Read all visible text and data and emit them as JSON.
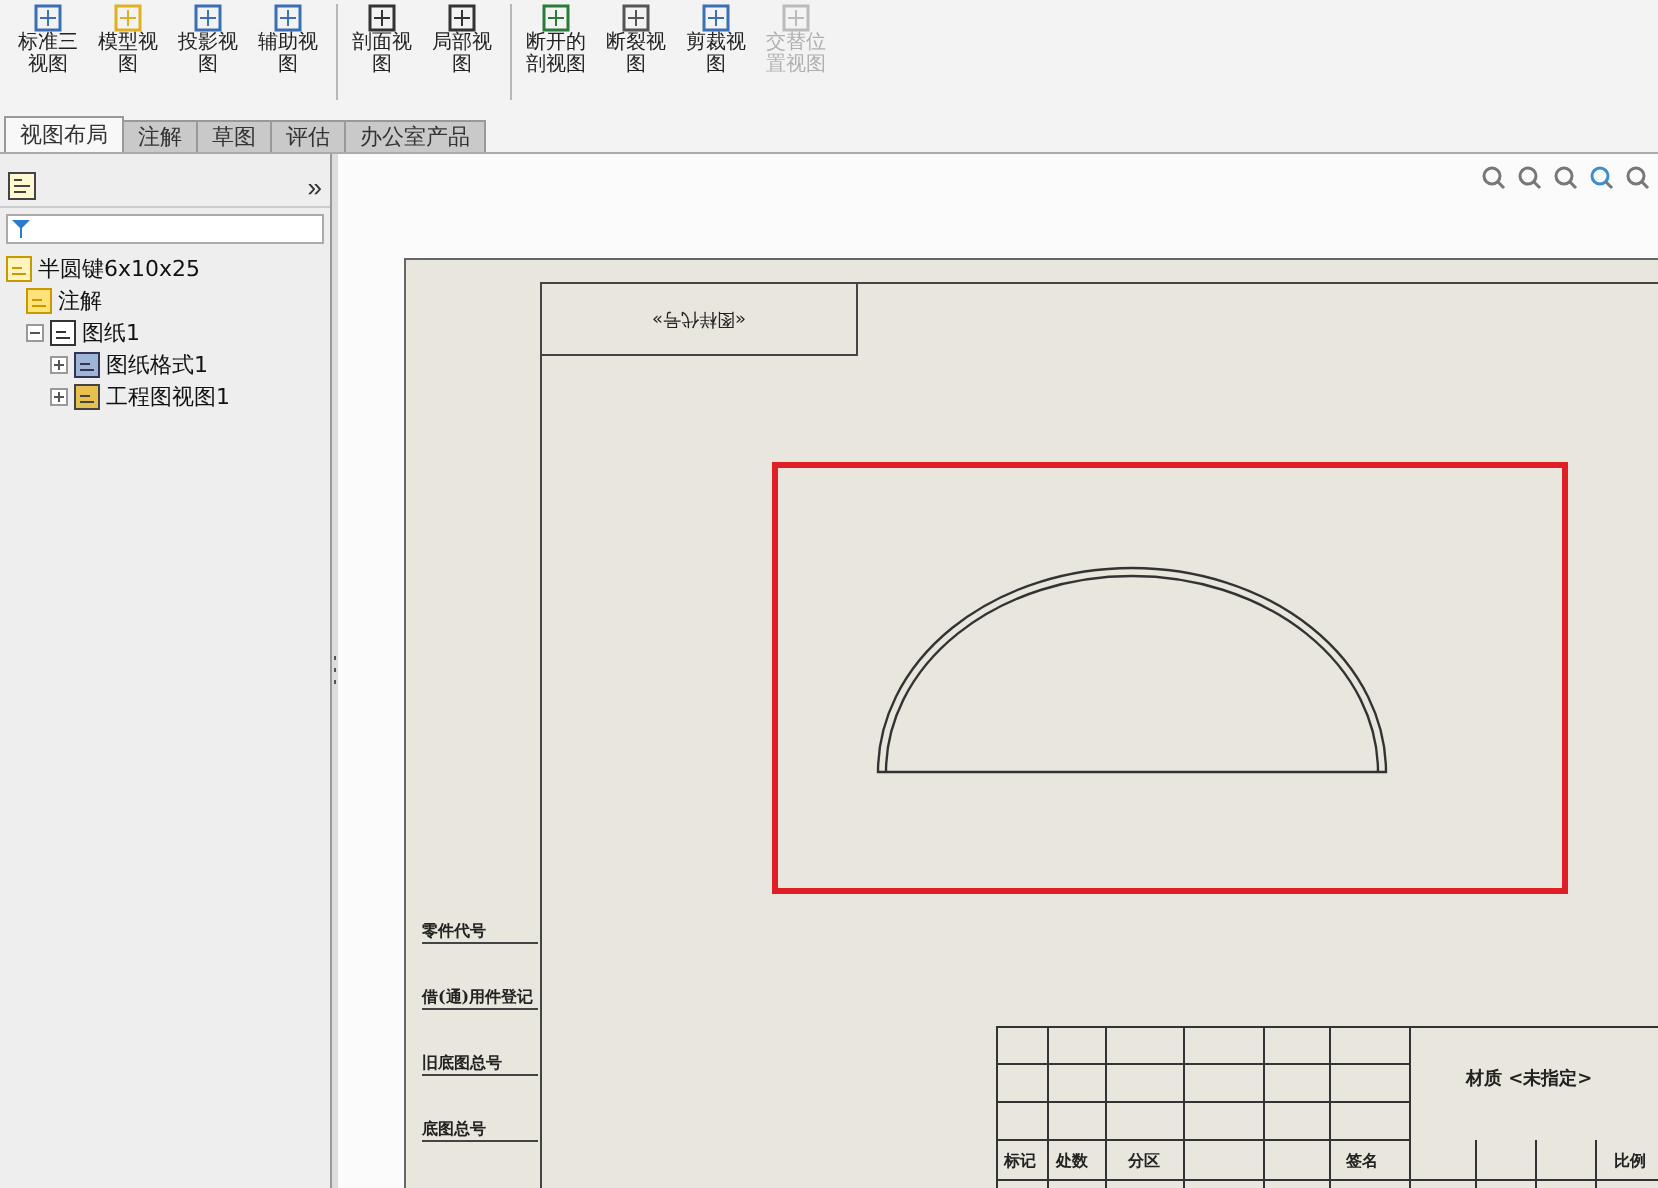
{
  "toolbar": {
    "groups": [
      [
        {
          "lines": [
            "标准三",
            "视图"
          ],
          "kind": "standard",
          "disabled": false
        },
        {
          "lines": [
            "模型视",
            "图"
          ],
          "kind": "model",
          "disabled": false
        },
        {
          "lines": [
            "投影视",
            "图"
          ],
          "kind": "projected",
          "disabled": false
        },
        {
          "lines": [
            "辅助视",
            "图"
          ],
          "kind": "auxiliary",
          "disabled": false
        }
      ],
      [
        {
          "lines": [
            "剖面视",
            "图"
          ],
          "kind": "section",
          "disabled": false
        },
        {
          "lines": [
            "局部视",
            "图"
          ],
          "kind": "detail",
          "disabled": false
        }
      ],
      [
        {
          "lines": [
            "断开的",
            "剖视图"
          ],
          "kind": "broken",
          "disabled": false
        },
        {
          "lines": [
            "断裂视",
            "图"
          ],
          "kind": "break",
          "disabled": false
        },
        {
          "lines": [
            "剪裁视",
            "图"
          ],
          "kind": "crop",
          "disabled": false
        },
        {
          "lines": [
            "交替位",
            "置视图"
          ],
          "kind": "alternate",
          "disabled": true
        }
      ]
    ]
  },
  "tabs": [
    {
      "label": "视图布局",
      "selected": true
    },
    {
      "label": "注解",
      "selected": false
    },
    {
      "label": "草图",
      "selected": false
    },
    {
      "label": "评估",
      "selected": false
    },
    {
      "label": "办公室产品",
      "selected": false
    }
  ],
  "panel": {
    "collapse_glyph": "»"
  },
  "feature_tree": [
    {
      "label": "半圆键6x10x25",
      "kind": "part",
      "children": [
        {
          "label": "注解",
          "kind": "annotation"
        },
        {
          "label": "图纸1",
          "kind": "sheet",
          "expanded": true,
          "children": [
            {
              "label": "图纸格式1",
              "kind": "format",
              "expanded": false
            },
            {
              "label": "工程图视图1",
              "kind": "view",
              "expanded": false
            }
          ]
        }
      ]
    }
  ],
  "drawing_sheet": {
    "code_field": "«图样代号»",
    "highlighted": true,
    "side_labels": [
      "零件代号",
      "借(通)用件登记",
      "旧底图总号",
      "底图总号"
    ],
    "title_block": {
      "material": "材质 <未指定>",
      "header_labels": [
        "标记",
        "处数",
        "分区",
        "签名"
      ],
      "scale_label": "比例"
    }
  }
}
